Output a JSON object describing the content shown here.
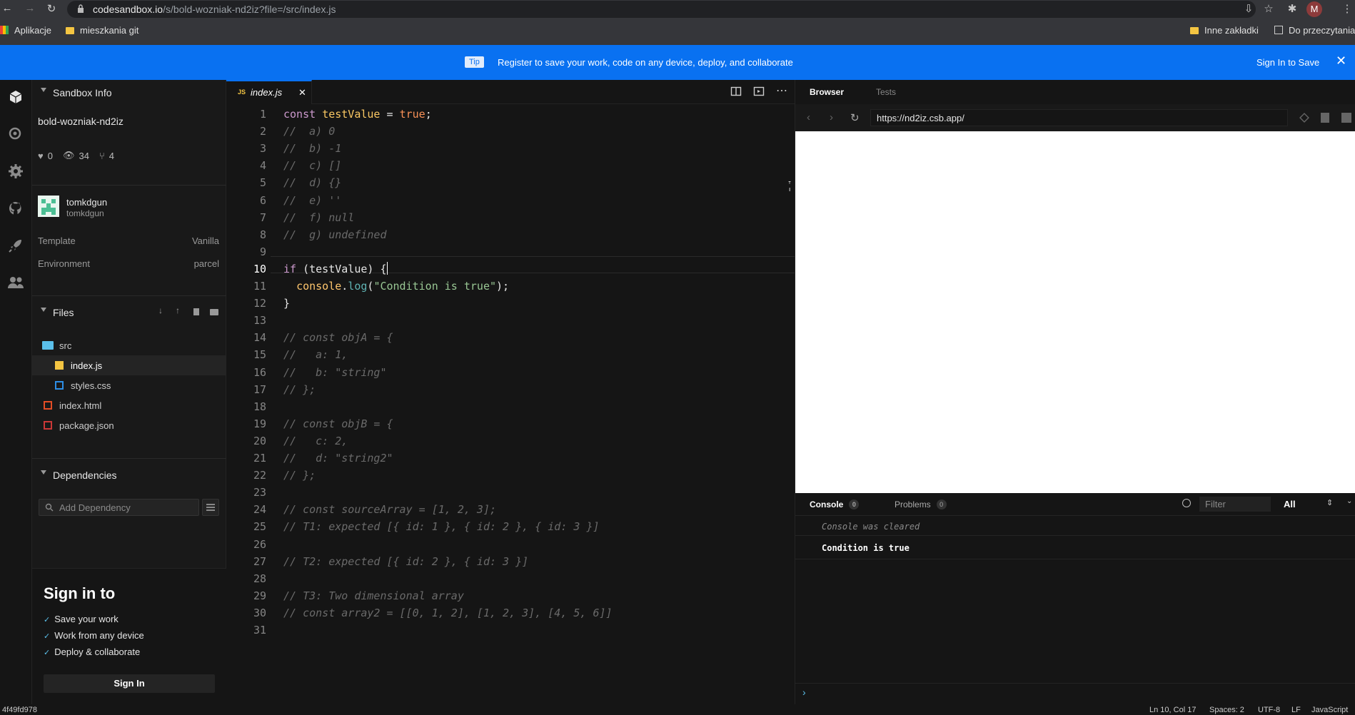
{
  "browser": {
    "url_host": "codesandbox.io",
    "url_path": "/s/bold-wozniak-nd2iz?file=/src/index.js",
    "avatar_letter": "M",
    "bookmarks": {
      "apps": "Aplikacje",
      "left": [
        "mieszkania git"
      ],
      "right": [
        "Inne zakładki",
        "Do przeczytania"
      ]
    }
  },
  "banner": {
    "tip": "Tip",
    "message": "Register to save your work, code on any device, deploy, and collaborate",
    "sign_in": "Sign In to Save"
  },
  "sidebar": {
    "info_title": "Sandbox Info",
    "sandbox_name": "bold-wozniak-nd2iz",
    "stats": {
      "likes": "0",
      "views": "34",
      "forks": "4"
    },
    "author": {
      "name": "tomkdgun",
      "username": "tomkdgun"
    },
    "meta": [
      {
        "key": "Template",
        "value": "Vanilla"
      },
      {
        "key": "Environment",
        "value": "parcel"
      }
    ],
    "files_title": "Files",
    "files": [
      {
        "name": "src",
        "type": "folder"
      },
      {
        "name": "index.js",
        "type": "js"
      },
      {
        "name": "styles.css",
        "type": "css"
      },
      {
        "name": "index.html",
        "type": "html"
      },
      {
        "name": "package.json",
        "type": "json"
      }
    ],
    "deps_title": "Dependencies",
    "dep_placeholder": "Add Dependency",
    "signin": {
      "title": "Sign in to",
      "items": [
        "Save your work",
        "Work from any device",
        "Deploy & collaborate"
      ],
      "button": "Sign In"
    }
  },
  "editor": {
    "tab_label": "index.js",
    "tab_badge": "JS",
    "current_line": 10
  },
  "preview": {
    "tabs": [
      "Browser",
      "Tests"
    ],
    "address": "https://nd2iz.csb.app/",
    "console_tab": "Console",
    "console_count": "0",
    "problems_tab": "Problems",
    "problems_count": "0",
    "filter_placeholder": "Filter",
    "level": "All",
    "messages": [
      "Console was cleared",
      "Condition is true"
    ],
    "prompt": "›"
  },
  "status": {
    "hash": "4f49fd978",
    "position": "Ln 10, Col 17",
    "spaces": "Spaces: 2",
    "encoding": "UTF-8",
    "eol": "LF",
    "language": "JavaScript"
  },
  "colors": {
    "accent": "#0971f1",
    "background": "#151515"
  }
}
